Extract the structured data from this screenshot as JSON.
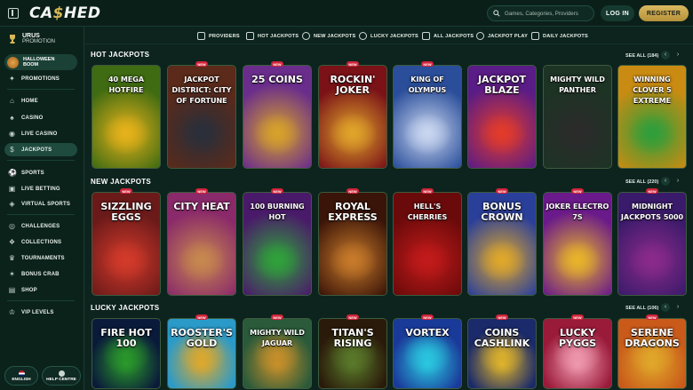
{
  "header": {
    "logo_text_a": "CA",
    "logo_text_b": "$",
    "logo_text_c": "HED",
    "search_placeholder": "Games, Categories, Providers",
    "login_label": "LOG IN",
    "register_label": "REGISTER"
  },
  "sidebar": {
    "promo_title": "URUS",
    "promo_subtitle": "PROMOTION",
    "halloween_line1": "HALLOWEEN",
    "halloween_line2": "BOOM",
    "items": [
      {
        "label": "PROMOTIONS"
      },
      {
        "label": "HOME"
      },
      {
        "label": "CASINO"
      },
      {
        "label": "LIVE CASINO"
      },
      {
        "label": "JACKPOTS"
      },
      {
        "label": "SPORTS"
      },
      {
        "label": "LIVE BETTING"
      },
      {
        "label": "VIRTUAL SPORTS"
      },
      {
        "label": "CHALLENGES"
      },
      {
        "label": "COLLECTIONS"
      },
      {
        "label": "TOURNAMENTS"
      },
      {
        "label": "BONUS CRAB"
      },
      {
        "label": "SHOP"
      },
      {
        "label": "VIP LEVELS"
      }
    ],
    "language_label": "ENGLISH",
    "help_label": "HELP CENTRE"
  },
  "categories": [
    {
      "label": "PROVIDERS"
    },
    {
      "label": "HOT JACKPOTS"
    },
    {
      "label": "NEW JACKPOTS"
    },
    {
      "label": "LUCKY JACKPOTS"
    },
    {
      "label": "ALL JACKPOTS"
    },
    {
      "label": "JACKPOT PLAY"
    },
    {
      "label": "DAILY JACKPOTS"
    }
  ],
  "sections": [
    {
      "title": "HOT JACKPOTS",
      "see_all": "SEE ALL (184)",
      "games": [
        {
          "name": "40 MEGA HOTFIRE",
          "new": "",
          "bg": "#3f6b12",
          "art": "#e6b21a"
        },
        {
          "name": "JACKPOT DISTRICT: CITY OF FORTUNE",
          "new": "NEW",
          "bg": "#5b2a1a",
          "art": "#2a2f3a"
        },
        {
          "name": "25 COINS",
          "new": "NEW",
          "bg": "#6a2d8c",
          "art": "#d7a22a"
        },
        {
          "name": "ROCKIN' JOKER",
          "new": "NEW",
          "bg": "#7a1218",
          "art": "#e0a42a"
        },
        {
          "name": "KING OF OLYMPUS",
          "new": "NEW",
          "bg": "#2a4e9a",
          "art": "#c9d6f0"
        },
        {
          "name": "JACKPOT BLAZE",
          "new": "",
          "bg": "#5a1c86",
          "art": "#e33b2a"
        },
        {
          "name": "MIGHTY WILD PANTHER",
          "new": "",
          "bg": "#1d3324",
          "art": "#2b2b2b"
        },
        {
          "name": "WINNING CLOVER 5 EXTREME",
          "new": "",
          "bg": "#c98b12",
          "art": "#2f9e3a"
        }
      ]
    },
    {
      "title": "NEW JACKPOTS",
      "see_all": "SEE ALL (220)",
      "games": [
        {
          "name": "SIZZLING EGGS",
          "new": "NEW",
          "bg": "#6b1a1a",
          "art": "#d33a2a"
        },
        {
          "name": "CITY HEAT",
          "new": "NEW",
          "bg": "#8a2a6a",
          "art": "#c7884e"
        },
        {
          "name": "100 BURNING HOT",
          "new": "NEW",
          "bg": "#4a1a6a",
          "art": "#2fa23a"
        },
        {
          "name": "ROYAL EXPRESS",
          "new": "NEW",
          "bg": "#3a1408",
          "art": "#c77a2a"
        },
        {
          "name": "HELL'S CHERRIES",
          "new": "NEW",
          "bg": "#6a0a0a",
          "art": "#c21a1a"
        },
        {
          "name": "BONUS CROWN",
          "new": "NEW",
          "bg": "#2a3f9a",
          "art": "#e0a82a"
        },
        {
          "name": "JOKER ELECTRO 7S",
          "new": "NEW",
          "bg": "#6a1a8a",
          "art": "#e8b42a"
        },
        {
          "name": "MIDNIGHT JACKPOTS 5000",
          "new": "NEW",
          "bg": "#3a1a6a",
          "art": "#8a2a8a"
        }
      ]
    },
    {
      "title": "LUCKY JACKPOTS",
      "see_all": "SEE ALL (106)",
      "games": [
        {
          "name": "FIRE HOT 100",
          "new": "",
          "bg": "#0a1a3a",
          "art": "#2a9a2a"
        },
        {
          "name": "ROOSTER'S GOLD",
          "new": "NEW",
          "bg": "#2a9ac9",
          "art": "#e0a82a"
        },
        {
          "name": "MIGHTY WILD JAGUAR",
          "new": "NEW",
          "bg": "#2a5a3a",
          "art": "#c9902a"
        },
        {
          "name": "TITAN'S RISING",
          "new": "NEW",
          "bg": "#2a1a0a",
          "art": "#5a7a2a"
        },
        {
          "name": "VORTEX",
          "new": "NEW",
          "bg": "#1a3a9a",
          "art": "#2ac9e0"
        },
        {
          "name": "COINS CASHLINK",
          "new": "NEW",
          "bg": "#1a2a6a",
          "art": "#e0b42a"
        },
        {
          "name": "LUCKY PYGGS",
          "new": "NEW",
          "bg": "#9a1a3a",
          "art": "#f09ab0"
        },
        {
          "name": "SERENE DRAGONS",
          "new": "NEW",
          "bg": "#c95a1a",
          "art": "#e0a82a"
        }
      ]
    }
  ],
  "colors": {
    "background": "#0d231d",
    "accent_gold": "#d7b756",
    "badge_red": "#d1243a"
  }
}
